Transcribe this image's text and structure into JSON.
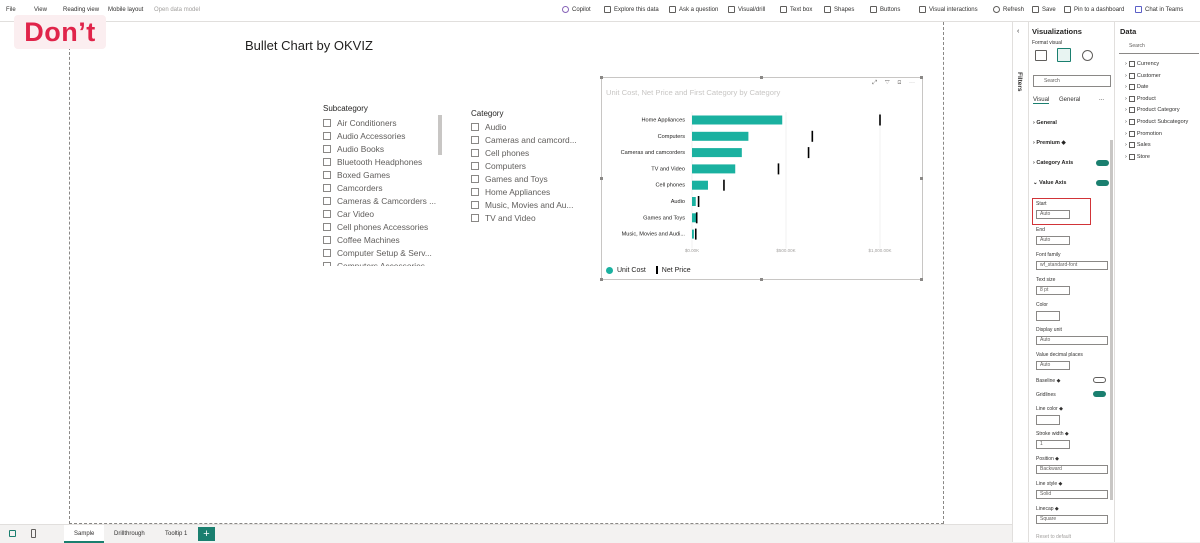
{
  "menu": {
    "file": "File",
    "view": "View",
    "reading": "Reading view",
    "mobile": "Mobile layout",
    "open_model": "Open data model"
  },
  "toolbar": {
    "copilot": "Copilot",
    "explore": "Explore this data",
    "ask": "Ask a question",
    "visual": "Visual/drill",
    "textbox": "Text box",
    "shapes": "Shapes",
    "buttons": "Buttons",
    "interactions": "Visual interactions",
    "refresh": "Refresh",
    "save": "Save",
    "pin": "Pin to a dashboard",
    "teams": "Chat in Teams"
  },
  "watermark": "Don’t",
  "page_title": "Bullet Chart by OKVIZ",
  "subcategory": {
    "title": "Subcategory",
    "items": [
      "Air Conditioners",
      "Audio Accessories",
      "Audio Books",
      "Bluetooth Headphones",
      "Boxed Games",
      "Camcorders",
      "Cameras & Camcorders ...",
      "Car Video",
      "Cell phones Accessories",
      "Coffee Machines",
      "Computer Setup & Serv...",
      "Computers Accessories"
    ]
  },
  "category": {
    "title": "Category",
    "items": [
      "Audio",
      "Cameras and camcord...",
      "Cell phones",
      "Computers",
      "Games and Toys",
      "Home Appliances",
      "Music, Movies and Au...",
      "TV and Video"
    ]
  },
  "visual_title": "Unit Cost, Net Price and First Category by Category",
  "visual_icons": "⤢ ▽ ⊡ ⋯",
  "legend": {
    "unit_cost": "Unit Cost",
    "net_price": "Net Price"
  },
  "colors": {
    "unit_cost": "#1ab1a0",
    "net_price": "#000000",
    "accent": "#1a7f6f",
    "highlight": "#d13438"
  },
  "chart_data": {
    "type": "bar",
    "categories": [
      "Home Appliances",
      "Computers",
      "Cameras and camcorders",
      "TV and Video",
      "Cell phones",
      "Audio",
      "Games and Toys",
      "Music, Movies and Audi..."
    ],
    "series": [
      {
        "name": "Unit Cost",
        "values": [
          480,
          300,
          265,
          230,
          85,
          20,
          25,
          10
        ]
      },
      {
        "name": "Net Price",
        "values": [
          1000,
          640,
          620,
          460,
          170,
          35,
          25,
          20
        ]
      }
    ],
    "x_ticks": [
      "$0.00K",
      "$500.00K",
      "$1,000.00K"
    ],
    "xlim": [
      0,
      1000
    ],
    "legend_position": "bottom-left"
  },
  "tabs": {
    "sample": "Sample",
    "drill": "Drillthrough",
    "tooltip": "Tooltip 1",
    "add": "+"
  },
  "filters_label": "Filters",
  "viz": {
    "title": "Visualizations",
    "format": "Format visual",
    "search": "Search",
    "tab_visual": "Visual",
    "tab_general": "General",
    "more": "...",
    "sections": {
      "general": "General",
      "premium": "Premium ◆",
      "category_axis": "Category Axis",
      "value_axis": "Value Axis"
    },
    "toggle_on": "On",
    "toggle_off": "Off",
    "start_label": "Start",
    "start_value": "Auto",
    "end_label": "End",
    "end_value": "Auto",
    "font_label": "Font family",
    "font_value": "wf_standard-font",
    "size_label": "Text size",
    "size_value": "8 pt",
    "color_label": "Color",
    "unit_label": "Display unit",
    "unit_value": "Auto",
    "decimal_label": "Value decimal places",
    "decimal_value": "Auto",
    "baseline_label": "Baseline ◆",
    "gridlines_label": "Gridlines",
    "linecolor_label": "Line color ◆",
    "stroke_label": "Stroke width ◆",
    "stroke_value": "1",
    "position_label": "Position ◆",
    "position_value": "Backward",
    "linestyle_label": "Line style ◆",
    "linestyle_value": "Solid",
    "linecap_label": "Linecap ◆",
    "linecap_value": "Square",
    "reset": "Reset to default"
  },
  "data": {
    "title": "Data",
    "search": "Search",
    "tables": [
      "Currency",
      "Customer",
      "Date",
      "Product",
      "Product Category",
      "Product Subcategory",
      "Promotion",
      "Sales",
      "Store"
    ]
  }
}
